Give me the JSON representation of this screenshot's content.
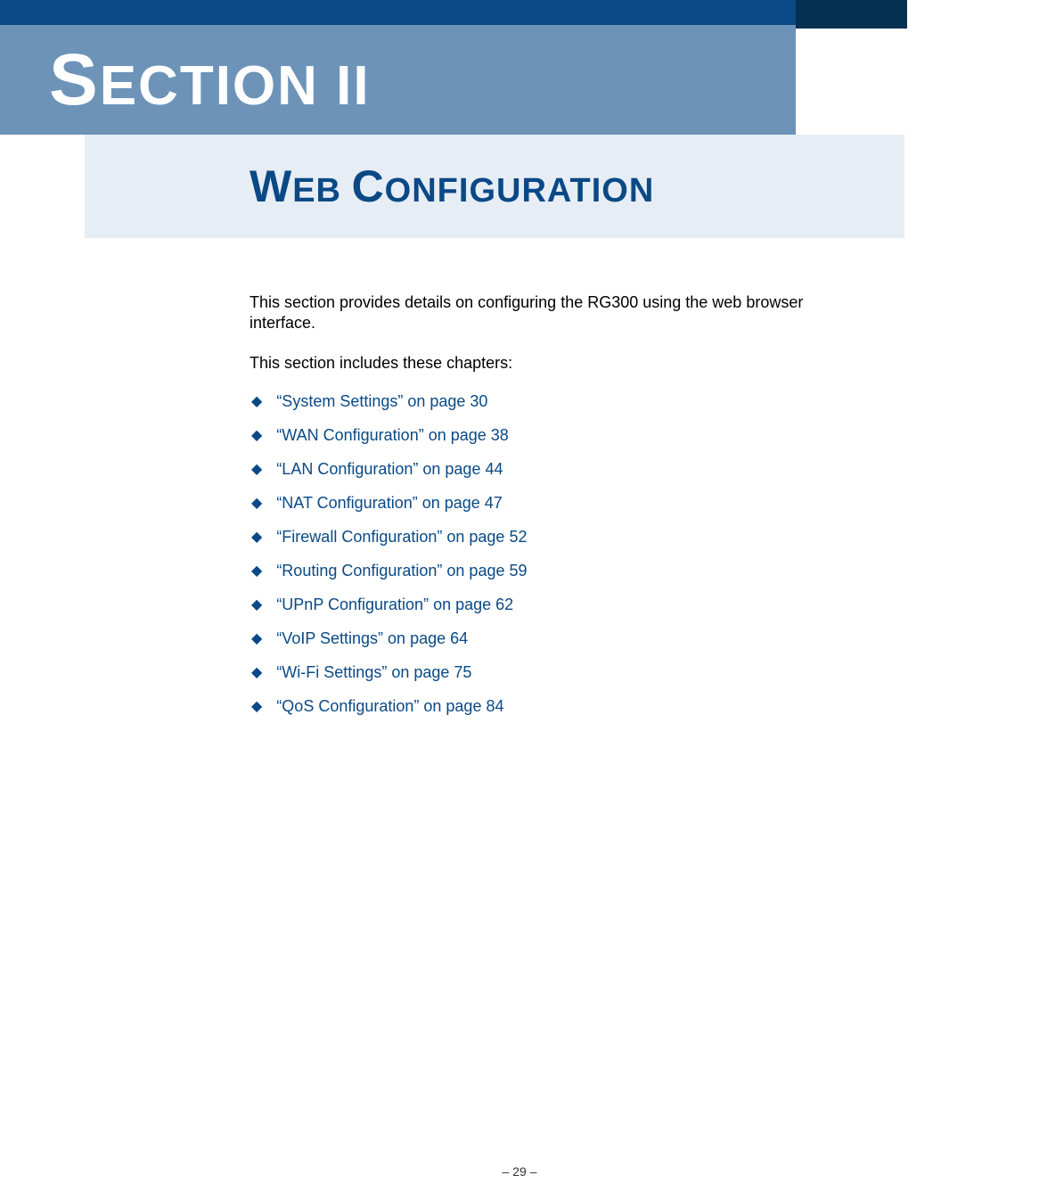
{
  "header": {
    "section_label": "SECTION",
    "section_number": "II"
  },
  "title": {
    "word1_first": "W",
    "word1_rest": "EB",
    "word2_first": "C",
    "word2_rest": "ONFIGURATION"
  },
  "content": {
    "intro": "This section provides details on configuring the RG300 using the web browser interface.",
    "list_heading": "This section includes these chapters:",
    "chapters": [
      "“System Settings” on page 30",
      "“WAN Configuration” on page 38",
      "“LAN Configuration” on page 44",
      "“NAT Configuration” on page 47",
      "“Firewall Configuration” on page 52",
      "“Routing Configuration” on page 59",
      "“UPnP Configuration” on page 62",
      "“VoIP Settings” on page 64",
      "“Wi-Fi Settings” on page 75",
      "“QoS Configuration” on page 84"
    ]
  },
  "footer": {
    "page_number": "–  29  –"
  }
}
